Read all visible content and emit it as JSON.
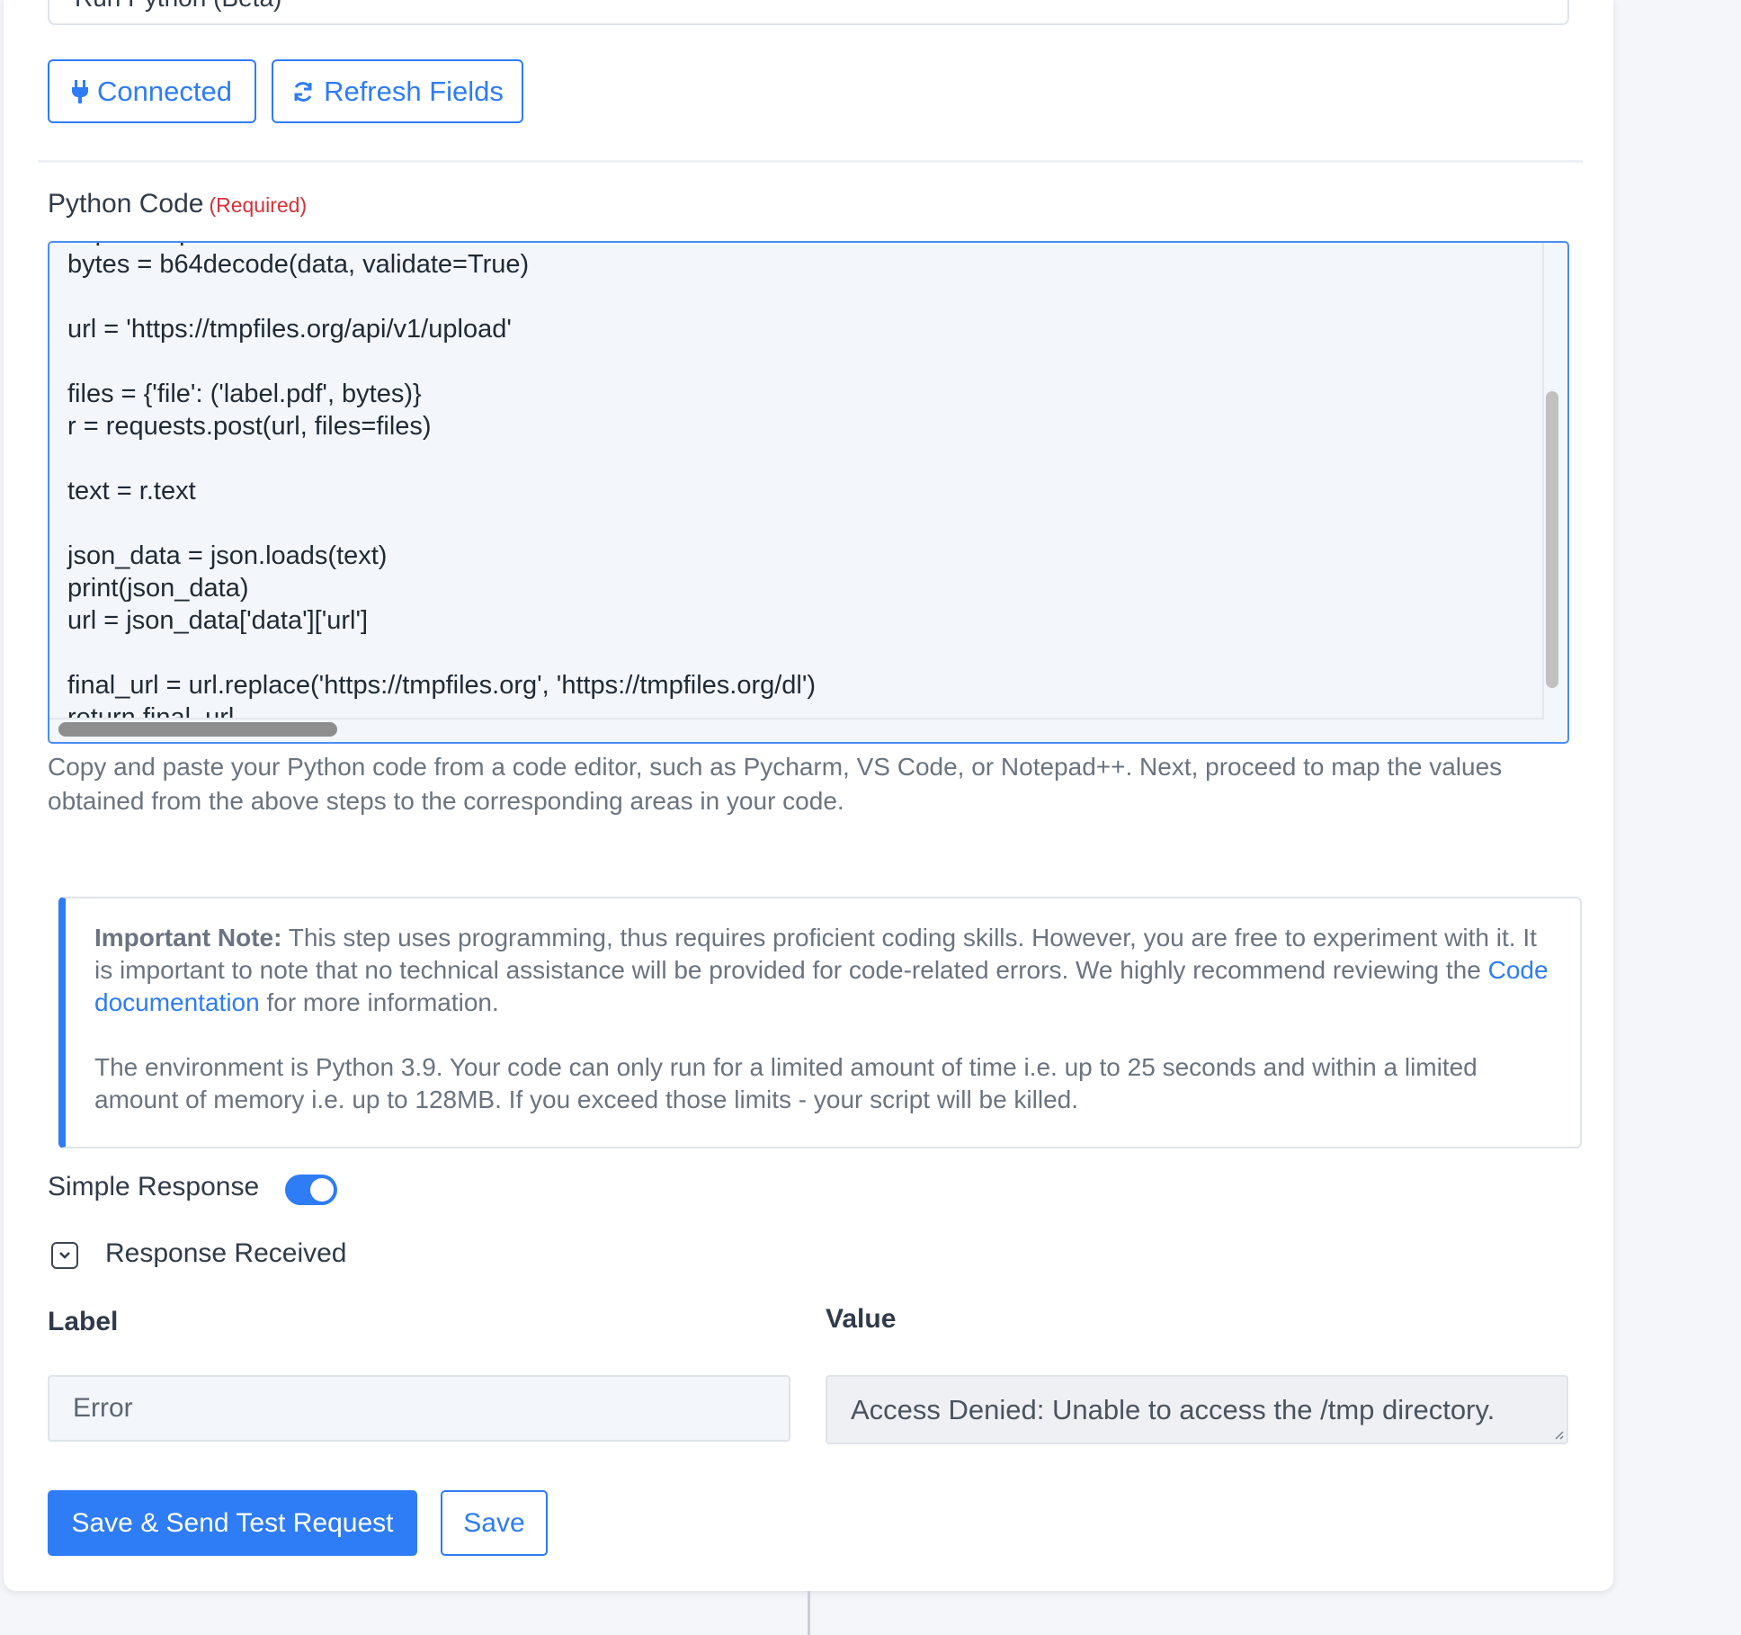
{
  "step": {
    "action_value": "Run Python (Beta)"
  },
  "toolbar": {
    "connected_label": "Connected",
    "refresh_label": "Refresh Fields"
  },
  "code_field": {
    "label": "Python Code",
    "required": "(Required)",
    "lines": [
      "import requests",
      "bytes = b64decode(data, validate=True)",
      "",
      "url = 'https://tmpfiles.org/api/v1/upload'",
      "",
      "files = {'file': ('label.pdf', bytes)}",
      "r = requests.post(url, files=files)",
      "",
      "text = r.text",
      "",
      "json_data = json.loads(text)",
      "print(json_data)",
      "url = json_data['data']['url']",
      "",
      "final_url = url.replace('https://tmpfiles.org', 'https://tmpfiles.org/dl')",
      "return final_url"
    ],
    "help": "Copy and paste your Python code from a code editor, such as Pycharm, VS Code, or Notepad++. Next, proceed to map the values obtained from the above steps to the corresponding areas in your code."
  },
  "note": {
    "title": "Important Note:",
    "text1": " This step uses programming, thus requires proficient coding skills. However, you are free to experiment with it. It is important to note that no technical assistance will be provided for code-related errors. We highly recommend reviewing the ",
    "link": "Code documentation",
    "text1_end": " for more information.",
    "text2": "The environment is Python 3.9. Your code can only run for a limited amount of time i.e. up to 25 seconds and within a limited amount of memory i.e. up to 128MB. If you exceed those limits - your script will be killed."
  },
  "simple_response": {
    "label": "Simple Response",
    "enabled": true
  },
  "response": {
    "title": "Response Received",
    "label_header": "Label",
    "value_header": "Value",
    "label": "Error",
    "value": "Access Denied: Unable to access the /tmp directory."
  },
  "actions": {
    "send_test": "Save & Send Test Request",
    "save": "Save"
  },
  "colors": {
    "accent": "#2e7cf6",
    "required": "#d6303a"
  }
}
